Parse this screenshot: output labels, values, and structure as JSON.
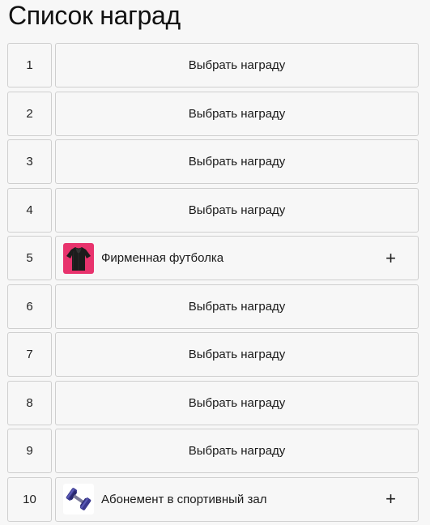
{
  "page": {
    "title": "Список наград"
  },
  "rewards": [
    {
      "number": "1",
      "label": "Выбрать награду",
      "selected": false
    },
    {
      "number": "2",
      "label": "Выбрать награду",
      "selected": false
    },
    {
      "number": "3",
      "label": "Выбрать награду",
      "selected": false
    },
    {
      "number": "4",
      "label": "Выбрать награду",
      "selected": false
    },
    {
      "number": "5",
      "label": "Фирменная футболка",
      "selected": true,
      "icon": "tshirt-image",
      "action_icon": "plus-icon",
      "action_symbol": "+"
    },
    {
      "number": "6",
      "label": "Выбрать награду",
      "selected": false
    },
    {
      "number": "7",
      "label": "Выбрать награду",
      "selected": false
    },
    {
      "number": "8",
      "label": "Выбрать награду",
      "selected": false
    },
    {
      "number": "9",
      "label": "Выбрать награду",
      "selected": false
    },
    {
      "number": "10",
      "label": "Абонемент в спортивный зал",
      "selected": true,
      "icon": "dumbbell-image",
      "action_icon": "plus-icon",
      "action_symbol": "+"
    }
  ],
  "colors": {
    "background": "#f7f7f7",
    "border": "#cfcfcf",
    "tshirt_bg": "#e8336d",
    "dumbbell_color": "#3b3a8f"
  }
}
